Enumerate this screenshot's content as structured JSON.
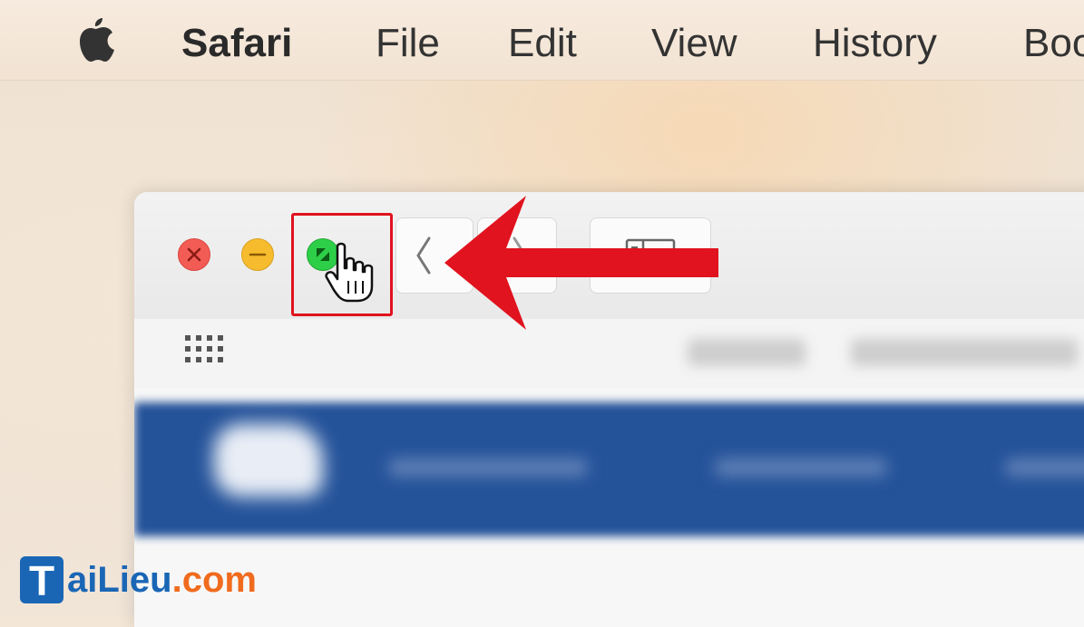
{
  "menubar": {
    "app_name": "Safari",
    "items": [
      "File",
      "Edit",
      "View",
      "History",
      "Boo"
    ]
  },
  "window": {
    "traffic_lights": [
      "close",
      "minimize",
      "fullscreen"
    ],
    "highlighted_control": "fullscreen"
  },
  "watermark": {
    "t": "T",
    "ai": "ai",
    "lieu": "Lieu",
    "com": ".com"
  },
  "colors": {
    "close": "#f25c55",
    "minimize": "#f7bc2e",
    "fullscreen": "#2ecf48",
    "annotation": "#e0131e",
    "watermark_blue": "#1a66b5",
    "watermark_orange": "#f06b1d"
  }
}
